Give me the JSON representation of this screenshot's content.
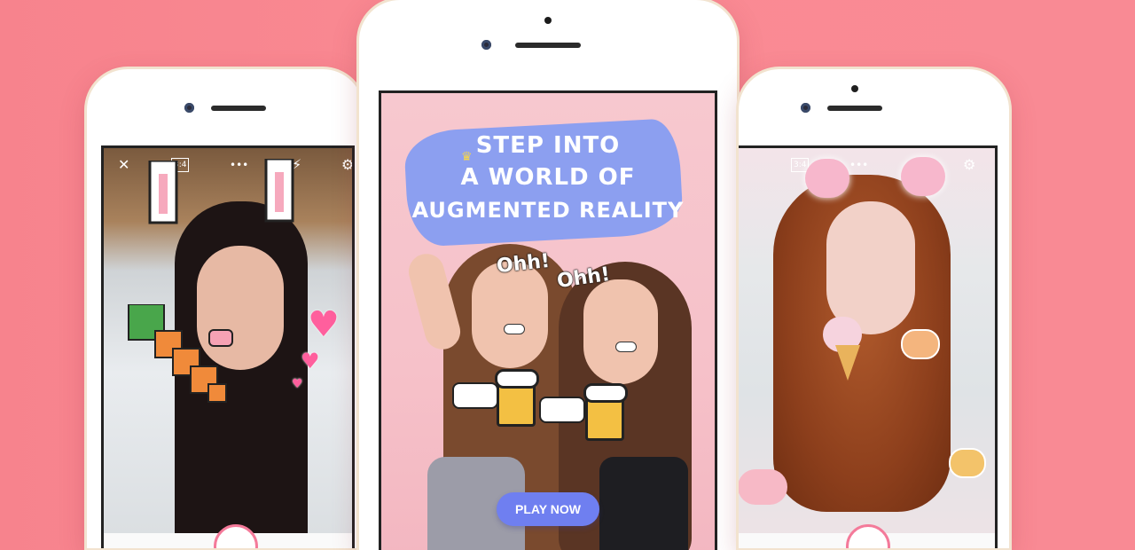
{
  "center_ad": {
    "headline_line1": "STEP INTO",
    "headline_line2": "A WORLD OF",
    "headline_line3": "AUGMENTED REALITY",
    "sticker_text_1": "Ohh!",
    "sticker_text_2": "Ohh!",
    "play_button": "PLAY NOW"
  },
  "left_phone": {
    "close_icon": "✕",
    "ratio_label": "3:4",
    "more_icon": "•••",
    "flash_icon": "⚡",
    "settings_icon": "⚙"
  },
  "right_phone": {
    "ratio_label": "3:4",
    "more_icon": "•••",
    "flash_icon": "⚡",
    "settings_icon": "⚙"
  },
  "colors": {
    "background": "#f98a94",
    "play_button": "#6f7ff0",
    "brush": "#8c9ff0",
    "shutter_ring": "#f47a9a"
  }
}
